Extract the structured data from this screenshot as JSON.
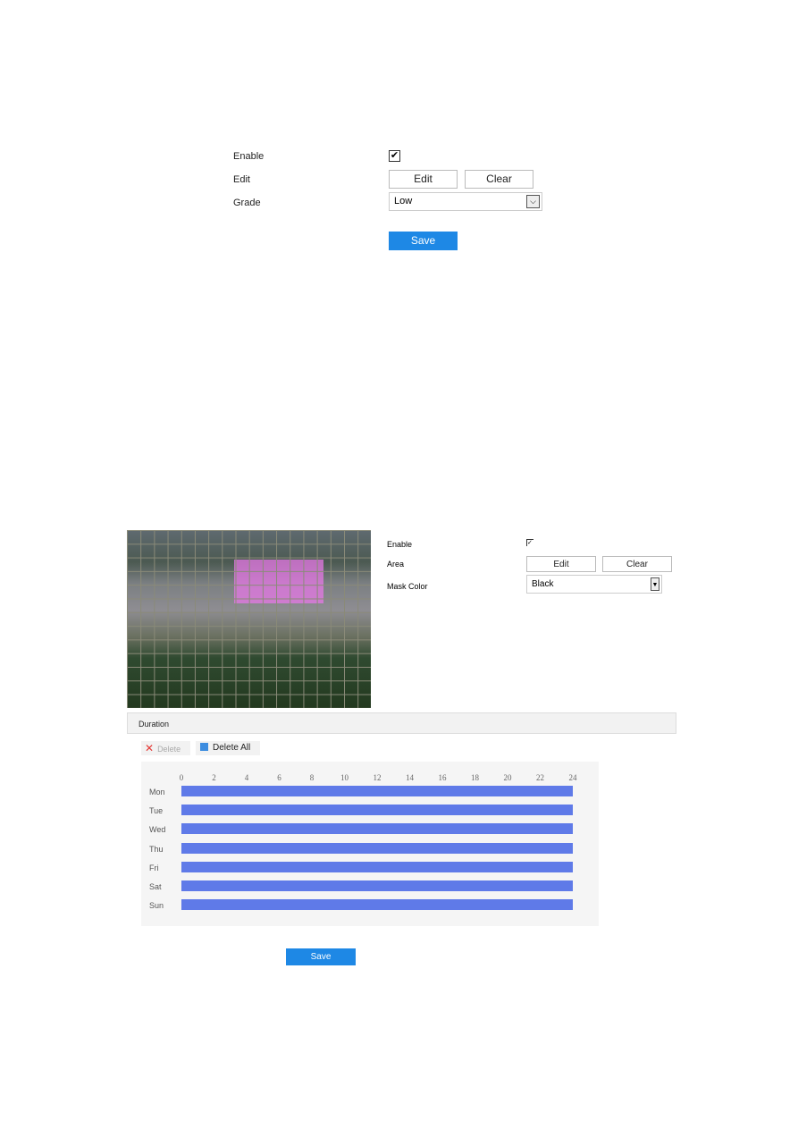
{
  "top_form": {
    "enable_label": "Enable",
    "enable_checked": true,
    "edit_label": "Edit",
    "edit_button": "Edit",
    "clear_button": "Clear",
    "grade_label": "Grade",
    "grade_value": "Low",
    "save_button": "Save"
  },
  "mask_form": {
    "enable_label": "Enable",
    "enable_checked": true,
    "area_label": "Area",
    "edit_button": "Edit",
    "clear_button": "Clear",
    "mask_color_label": "Mask Color",
    "mask_color_value": "Black"
  },
  "duration": {
    "title": "Duration",
    "delete_button": "Delete",
    "delete_all_button": "Delete All",
    "hour_ticks": [
      "0",
      "2",
      "4",
      "6",
      "8",
      "10",
      "12",
      "14",
      "16",
      "18",
      "20",
      "22",
      "24"
    ],
    "days": [
      {
        "label": "Mon",
        "start": 0,
        "end": 24
      },
      {
        "label": "Tue",
        "start": 0,
        "end": 24
      },
      {
        "label": "Wed",
        "start": 0,
        "end": 24
      },
      {
        "label": "Thu",
        "start": 0,
        "end": 24
      },
      {
        "label": "Fri",
        "start": 0,
        "end": 24
      },
      {
        "label": "Sat",
        "start": 0,
        "end": 24
      },
      {
        "label": "Sun",
        "start": 0,
        "end": 24
      }
    ],
    "bar_color": "#5f7ae8"
  },
  "save_button": "Save",
  "colors": {
    "accent": "#1e88e5",
    "mask": "#e678e6"
  }
}
